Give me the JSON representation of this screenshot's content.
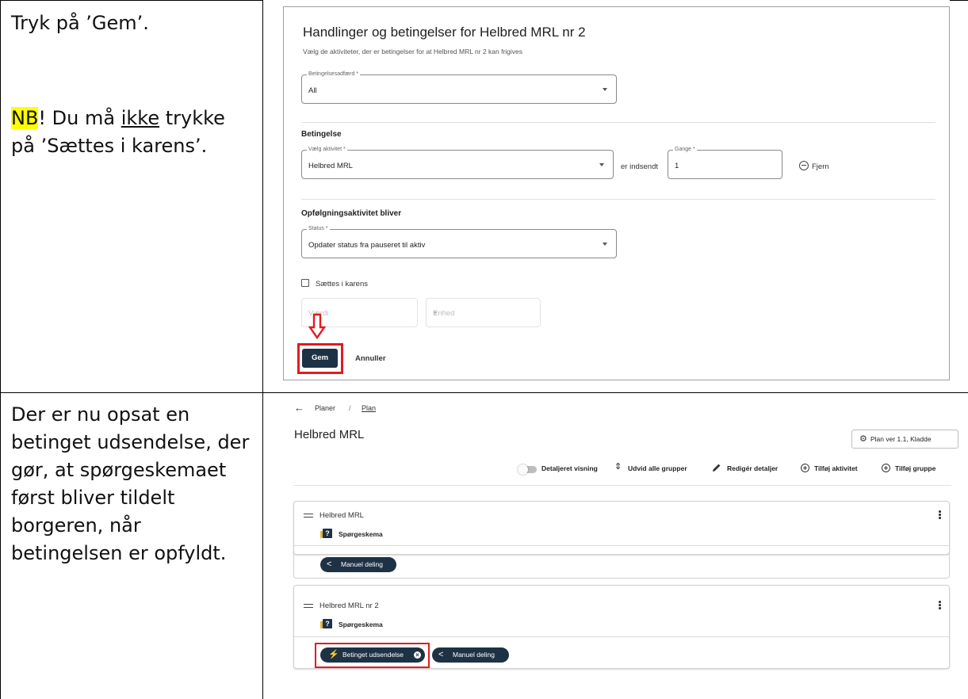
{
  "rows": [
    {
      "instruction": {
        "line1": "Tryk på ’Gem’.",
        "note_hl": "NB",
        "note_a": "! Du må ",
        "note_ul": "ikke",
        "note_b": " trykke på ’Sættes i karens’."
      }
    },
    {
      "instruction": {
        "text": "Der er nu opsat en betinget udsendelse, der gør, at spørgeskemaet først bliver tildelt borgeren, når betingelsen er opfyldt."
      }
    }
  ],
  "dialog": {
    "title": "Handlinger og betingelser for Helbred MRL nr 2",
    "subtitle": "Vælg de aktiviteter, der er betingelser for at Helbred MRL nr 2 kan frigives",
    "behavior_label": "Betingelsesadfærd *",
    "behavior_value": "All",
    "condition_heading": "Betingelse",
    "activity_label": "Vælg aktivitet *",
    "activity_value": "Helbred MRL",
    "submitted_text": "er indsendt",
    "times_label": "Gange *",
    "times_value": "1",
    "remove_label": "Fjern",
    "followup_heading": "Opfølgningsaktivitet bliver",
    "status_label": "Status *",
    "status_value": "Opdater status fra pauseret til aktiv",
    "quarantine_label": "Sættes i karens",
    "value_placeholder": "Værdi",
    "unit_placeholder": "Enhed",
    "save_label": "Gem",
    "cancel_label": "Annuller",
    "highlight_color": "#e11b22"
  },
  "plan": {
    "breadcrumb_1": "Planer",
    "breadcrumb_sep": "/",
    "breadcrumb_2": "Plan",
    "title": "Helbred MRL",
    "version_button": "Plan ver 1.1, Kladde",
    "toolbar": {
      "detailed_view": "Detaljeret visning",
      "expand_groups": "Udvid alle grupper",
      "edit_details": "Redigér detaljer",
      "add_activity": "Tilføj aktivitet",
      "add_group": "Tilføj gruppe"
    },
    "cards": [
      {
        "title": "Helbred MRL",
        "item": "Spørgeskema",
        "chips": [
          "Manuel deling"
        ]
      },
      {
        "title": "Helbred MRL nr 2",
        "item": "Spørgeskema",
        "chips": [
          "Betinget udsendelse",
          "Manuel deling"
        ]
      }
    ],
    "accent_color": "#1e3245"
  }
}
